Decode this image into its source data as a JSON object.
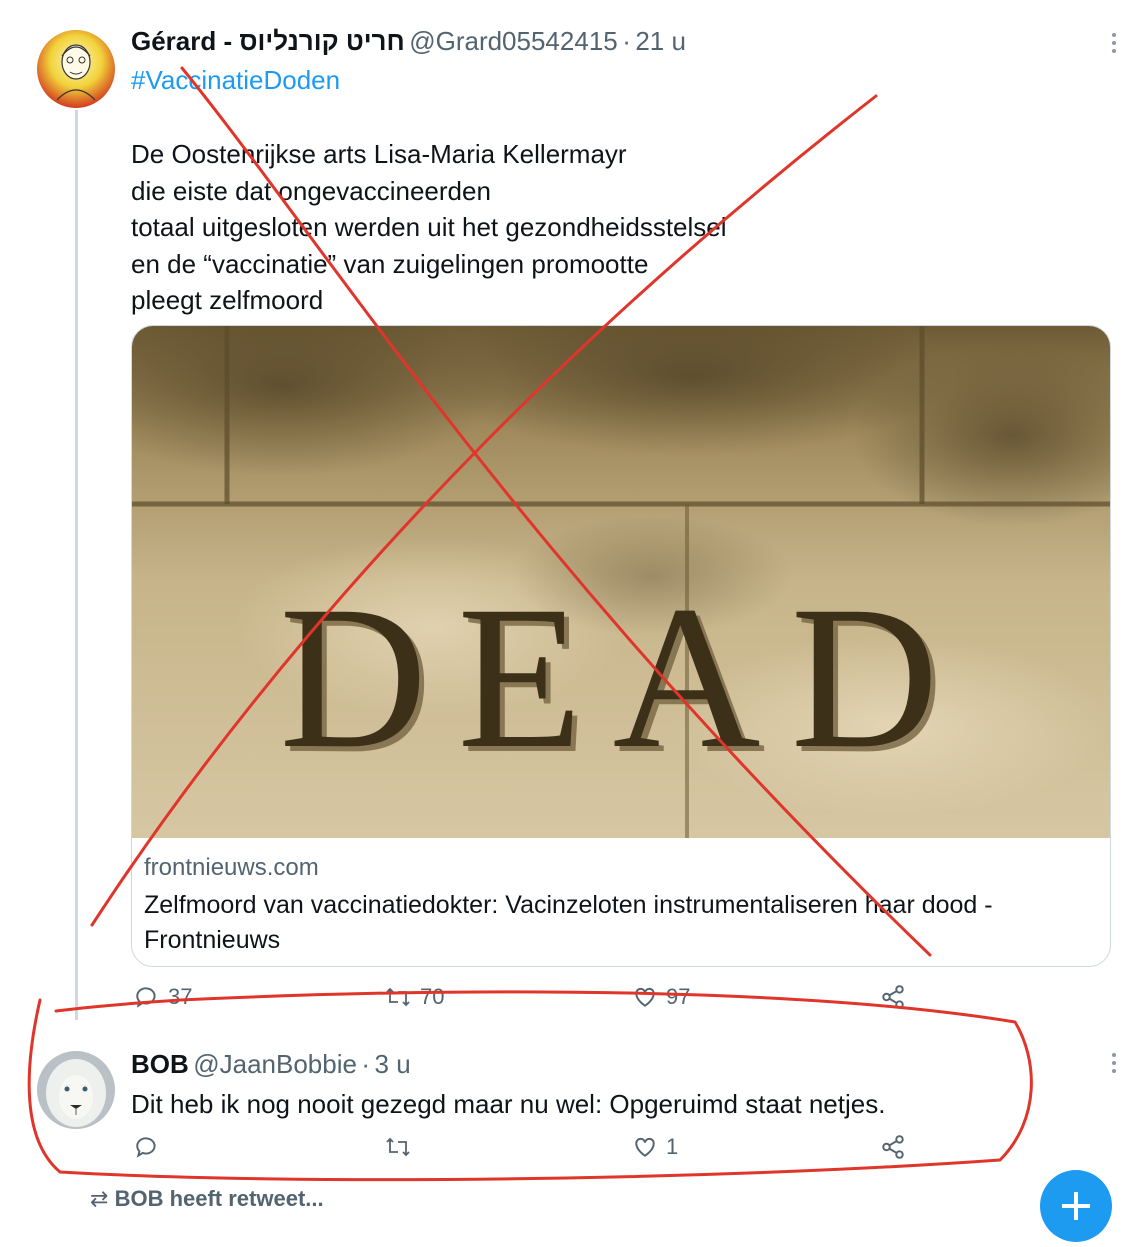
{
  "tweet": {
    "author_name": "Gérard - חריט קורנליוס",
    "handle": "@Grard05542415",
    "separator": "·",
    "time": "21 u",
    "hashtag": "#VaccinatieDoden",
    "body": "De Oostenrijkse arts Lisa-Maria Kellermayr\ndie eiste dat ongevaccineerden\ntotaal uitgesloten werden uit het gezondheidsstelsel\nen de “vaccinatie” van zuigelingen promootte\npleegt zelfmoord",
    "card": {
      "image_text": "DEAD",
      "domain": "frontnieuws.com",
      "title": "Zelfmoord van vaccinatiedokter: Vacinzeloten instrumentaliseren haar dood - Frontnieuws"
    },
    "actions": {
      "replies": "37",
      "retweets": "70",
      "likes": "97"
    }
  },
  "reply": {
    "author_name": "BOB",
    "handle": "@JaanBobbie",
    "separator": "·",
    "time": "3 u",
    "body": "Dit heb ik nog nooit gezegd maar nu wel: Opgeruimd staat netjes.",
    "actions": {
      "replies": "",
      "retweets": "",
      "likes": "1"
    }
  },
  "footer": {
    "retweet_notice": "BOB heeft retweet..."
  },
  "colors": {
    "accent": "#1d9bf0",
    "annotation": "#e0352b",
    "muted": "#536471"
  }
}
